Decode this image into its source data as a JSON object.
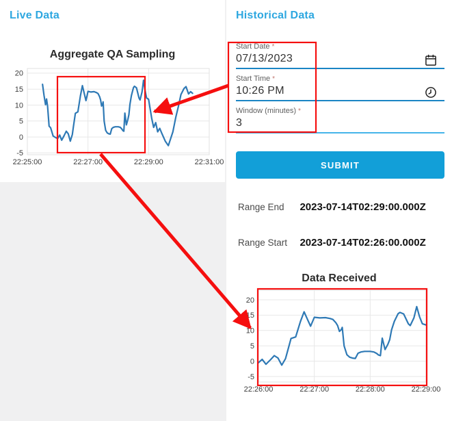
{
  "colors": {
    "accent_blue": "#2da7e0",
    "line_blue": "#2e79b5",
    "annotation_red": "#f50f0f",
    "submit_blue": "#129fd8",
    "underline_blue": "#1a85c4",
    "underline_light": "#45b4e9"
  },
  "left_panel": {
    "header": "Live Data"
  },
  "right_panel": {
    "header": "Historical Data",
    "form": {
      "required_mark": "*",
      "fields": [
        {
          "label": "Start Date",
          "value": "07/13/2023",
          "icon": "calendar"
        },
        {
          "label": "Start Time",
          "value": "10:26 PM",
          "icon": "clock"
        },
        {
          "label": "Window (minutes)",
          "value": "3",
          "icon": "none"
        }
      ]
    },
    "submit_label": "SUBMIT",
    "ranges": [
      {
        "label": "Range End",
        "value": "2023-07-14T02:29:00.000Z"
      },
      {
        "label": "Range Start",
        "value": "2023-07-14T02:26:00.000Z"
      }
    ]
  },
  "chart_data": [
    {
      "id": "live",
      "type": "line",
      "title": "Aggregate QA Sampling",
      "xlabel": "",
      "ylabel": "",
      "grid": true,
      "legend": "none",
      "t_min": -60,
      "t_max": 300,
      "time_reference": "seconds relative to 22:26:00",
      "x_ticks": [
        {
          "t": -60,
          "label": "22:25:00"
        },
        {
          "t": 60,
          "label": "22:27:00"
        },
        {
          "t": 180,
          "label": "22:29:00"
        },
        {
          "t": 300,
          "label": "22:31:00"
        }
      ],
      "y_ticks": [
        20,
        15,
        10,
        5,
        0,
        -5
      ],
      "ylim": [
        -6,
        21.5
      ],
      "points": [
        [
          -30,
          16.5
        ],
        [
          -27,
          13.0
        ],
        [
          -24,
          10.1
        ],
        [
          -22,
          11.9
        ],
        [
          -20,
          9.6
        ],
        [
          -17,
          3.4
        ],
        [
          -14,
          2.9
        ],
        [
          -9,
          0.3
        ],
        [
          -4,
          -0.2
        ],
        [
          0,
          -0.5
        ],
        [
          4,
          0.6
        ],
        [
          8,
          -1.0
        ],
        [
          13,
          0.5
        ],
        [
          17,
          1.8
        ],
        [
          21,
          1.0
        ],
        [
          25,
          -1.3
        ],
        [
          29,
          0.8
        ],
        [
          31,
          3.0
        ],
        [
          35,
          7.4
        ],
        [
          40,
          7.9
        ],
        [
          45,
          12.9
        ],
        [
          49,
          16.1
        ],
        [
          53,
          13.4
        ],
        [
          56,
          11.4
        ],
        [
          60,
          14.3
        ],
        [
          66,
          14.1
        ],
        [
          72,
          14.2
        ],
        [
          77,
          13.9
        ],
        [
          80,
          13.6
        ],
        [
          83,
          12.6
        ],
        [
          85,
          11.6
        ],
        [
          87,
          9.7
        ],
        [
          89,
          10.3
        ],
        [
          90,
          11.0
        ],
        [
          92,
          5.0
        ],
        [
          95,
          2.1
        ],
        [
          98,
          1.3
        ],
        [
          101,
          1.0
        ],
        [
          104,
          0.9
        ],
        [
          107,
          2.6
        ],
        [
          110,
          3.0
        ],
        [
          114,
          3.2
        ],
        [
          120,
          3.2
        ],
        [
          124,
          3.0
        ],
        [
          127,
          2.5
        ],
        [
          129,
          2.0
        ],
        [
          131,
          1.8
        ],
        [
          133,
          7.5
        ],
        [
          136,
          3.8
        ],
        [
          139,
          5.5
        ],
        [
          141,
          7.0
        ],
        [
          143,
          10.2
        ],
        [
          146,
          13.0
        ],
        [
          150,
          15.5
        ],
        [
          152,
          15.9
        ],
        [
          156,
          15.4
        ],
        [
          161,
          12.2
        ],
        [
          163,
          11.6
        ],
        [
          167,
          14.1
        ],
        [
          170,
          17.8
        ],
        [
          173,
          14.5
        ],
        [
          176,
          12.2
        ],
        [
          180,
          11.8
        ],
        [
          186,
          5.9
        ],
        [
          190,
          3.0
        ],
        [
          194,
          4.5
        ],
        [
          198,
          1.6
        ],
        [
          202,
          2.7
        ],
        [
          206,
          1.2
        ],
        [
          213,
          -1.3
        ],
        [
          219,
          -2.7
        ],
        [
          228,
          1.6
        ],
        [
          234,
          6.3
        ],
        [
          239,
          9.6
        ],
        [
          244,
          13.3
        ],
        [
          250,
          15.2
        ],
        [
          254,
          15.8
        ],
        [
          259,
          13.5
        ],
        [
          263,
          14.2
        ],
        [
          267,
          13.7
        ]
      ]
    },
    {
      "id": "recv",
      "type": "line",
      "title": "Data Received",
      "xlabel": "",
      "ylabel": "",
      "grid": true,
      "legend": "none",
      "t_min": 0,
      "t_max": 180,
      "time_reference": "seconds relative to 22:26:00",
      "x_ticks": [
        {
          "t": 0,
          "label": "22:26:00"
        },
        {
          "t": 60,
          "label": "22:27:00"
        },
        {
          "t": 120,
          "label": "22:28:00"
        },
        {
          "t": 180,
          "label": "22:29:00"
        }
      ],
      "y_ticks": [
        20,
        15,
        10,
        5,
        0,
        -5
      ],
      "ylim": [
        -6.8,
        23
      ],
      "points": [
        [
          0,
          -0.5
        ],
        [
          4,
          0.6
        ],
        [
          8,
          -1.0
        ],
        [
          13,
          0.5
        ],
        [
          17,
          1.8
        ],
        [
          21,
          1.0
        ],
        [
          25,
          -1.3
        ],
        [
          29,
          0.8
        ],
        [
          31,
          3.0
        ],
        [
          35,
          7.4
        ],
        [
          40,
          7.9
        ],
        [
          45,
          12.9
        ],
        [
          49,
          16.1
        ],
        [
          53,
          13.4
        ],
        [
          56,
          11.4
        ],
        [
          60,
          14.3
        ],
        [
          66,
          14.1
        ],
        [
          72,
          14.2
        ],
        [
          77,
          13.9
        ],
        [
          80,
          13.6
        ],
        [
          83,
          12.6
        ],
        [
          85,
          11.6
        ],
        [
          87,
          9.7
        ],
        [
          89,
          10.3
        ],
        [
          90,
          11.0
        ],
        [
          92,
          5.0
        ],
        [
          95,
          2.1
        ],
        [
          98,
          1.3
        ],
        [
          101,
          1.0
        ],
        [
          104,
          0.9
        ],
        [
          107,
          2.6
        ],
        [
          110,
          3.0
        ],
        [
          114,
          3.2
        ],
        [
          120,
          3.2
        ],
        [
          124,
          3.0
        ],
        [
          127,
          2.5
        ],
        [
          129,
          2.0
        ],
        [
          131,
          1.8
        ],
        [
          133,
          7.5
        ],
        [
          136,
          3.8
        ],
        [
          139,
          5.5
        ],
        [
          141,
          7.0
        ],
        [
          143,
          10.2
        ],
        [
          146,
          13.0
        ],
        [
          150,
          15.5
        ],
        [
          152,
          15.9
        ],
        [
          156,
          15.4
        ],
        [
          161,
          12.2
        ],
        [
          163,
          11.6
        ],
        [
          167,
          14.1
        ],
        [
          170,
          17.8
        ],
        [
          173,
          14.5
        ],
        [
          176,
          12.2
        ],
        [
          180,
          11.8
        ]
      ]
    }
  ]
}
